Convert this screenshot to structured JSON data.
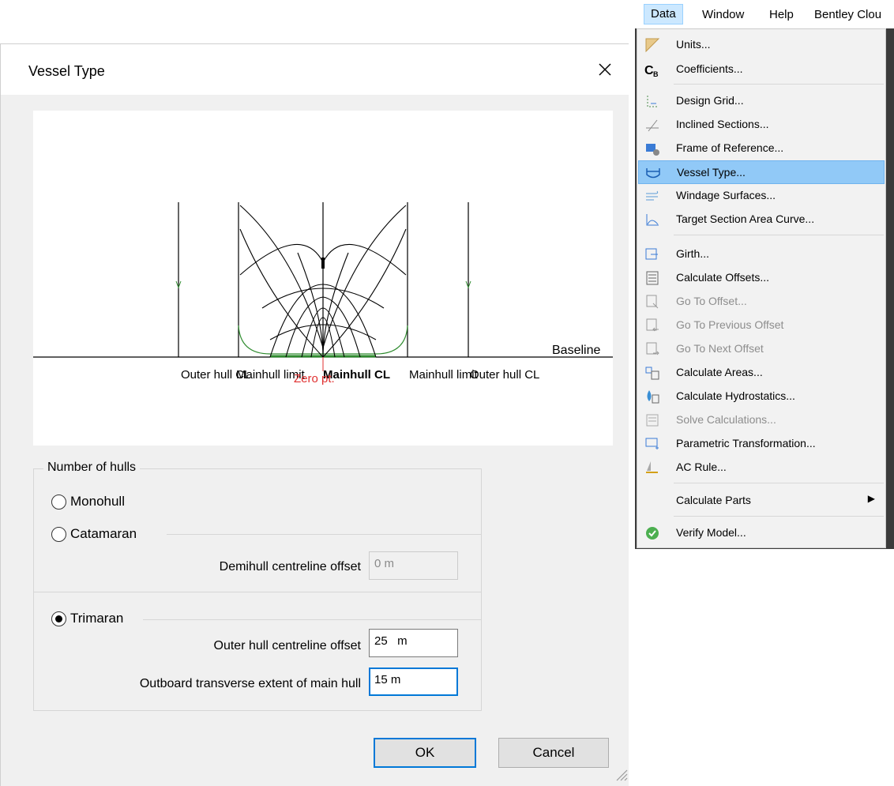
{
  "dialog": {
    "title": "Vessel Type",
    "close_glyph": "✕",
    "preview": {
      "baseline_label": "Baseline",
      "hull_labels": [
        "Outer hull CL",
        "Mainhull limit",
        "Mainhull CL",
        "Mainhull limit",
        "Outer hull CL"
      ],
      "zero_label": "Zero pt."
    },
    "number_of_hulls": {
      "legend": "Number of hulls",
      "monohull": {
        "label": "Monohull",
        "selected": false
      },
      "catamaran": {
        "label": "Catamaran",
        "selected": false
      },
      "demihull_label": "Demihull centreline offset",
      "demihull_value": "0 m",
      "trimaran": {
        "label": "Trimaran",
        "selected": true
      },
      "outer_offset_label": "Outer hull centreline offset",
      "outer_offset_value": "25   m",
      "outboard_label": "Outboard transverse extent of main hull",
      "outboard_value": "15 m"
    },
    "ok_label": "OK",
    "cancel_label": "Cancel"
  },
  "menubar": {
    "items": [
      "Data",
      "Window",
      "Help",
      "Bentley Clou"
    ],
    "active": "Data"
  },
  "data_menu": {
    "items": [
      {
        "label": "Units...",
        "icon": "units-icon",
        "enabled": true
      },
      {
        "label": "Coefficients...",
        "icon": "coefficients-icon",
        "enabled": true
      },
      {
        "label": "Design Grid...",
        "icon": "design-grid-icon",
        "enabled": true
      },
      {
        "label": "Inclined Sections...",
        "icon": "inclined-sections-icon",
        "enabled": true
      },
      {
        "label": "Frame of Reference...",
        "icon": "frame-of-reference-icon",
        "enabled": true
      },
      {
        "label": "Vessel Type...",
        "icon": "vessel-type-icon",
        "enabled": true,
        "highlighted": true
      },
      {
        "label": "Windage Surfaces...",
        "icon": "windage-icon",
        "enabled": true
      },
      {
        "label": "Target Section Area Curve...",
        "icon": "section-area-curve-icon",
        "enabled": true
      },
      {
        "label": "Girth...",
        "icon": "girth-icon",
        "enabled": true
      },
      {
        "label": "Calculate Offsets...",
        "icon": "calculate-offsets-icon",
        "enabled": true
      },
      {
        "label": "Go To Offset...",
        "icon": "go-to-offset-icon",
        "enabled": false
      },
      {
        "label": "Go To Previous Offset",
        "icon": "go-to-previous-offset-icon",
        "enabled": false
      },
      {
        "label": "Go To Next Offset",
        "icon": "go-to-next-offset-icon",
        "enabled": false
      },
      {
        "label": "Calculate Areas...",
        "icon": "calculate-areas-icon",
        "enabled": true
      },
      {
        "label": "Calculate Hydrostatics...",
        "icon": "hydrostatics-icon",
        "enabled": true
      },
      {
        "label": "Solve Calculations...",
        "icon": "solve-calculations-icon",
        "enabled": false
      },
      {
        "label": "Parametric Transformation...",
        "icon": "parametric-transformation-icon",
        "enabled": true
      },
      {
        "label": "AC Rule...",
        "icon": "ac-rule-icon",
        "enabled": true
      },
      {
        "label": "Calculate Parts",
        "icon": "",
        "enabled": true,
        "submenu": true
      },
      {
        "label": "Verify Model...",
        "icon": "verify-model-icon",
        "enabled": true
      }
    ]
  },
  "colors": {
    "accent": "#0078d7",
    "menu_highlight": "#91c9f7",
    "hull_green": "#2e8b2e",
    "zero_red": "#e03030"
  }
}
